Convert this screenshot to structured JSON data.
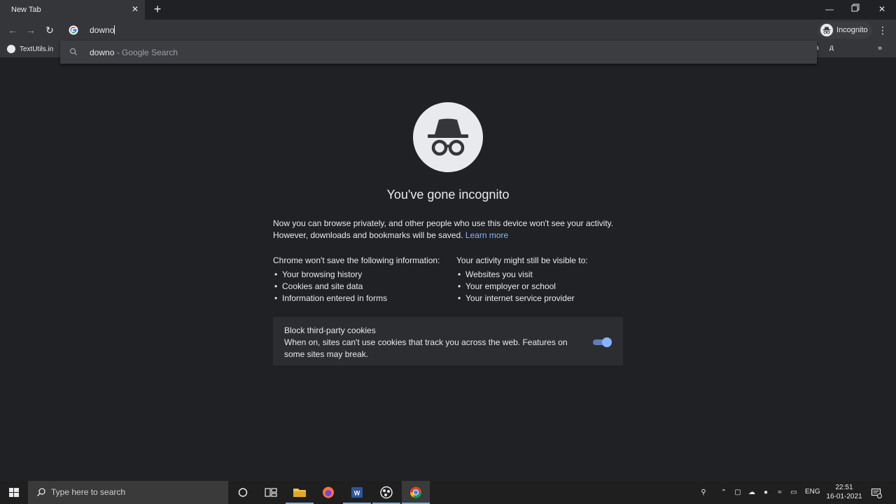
{
  "window": {
    "tab_title": "New Tab",
    "tab_close_icon": "close-icon",
    "new_tab_icon": "plus-icon",
    "controls": [
      "minimize-icon",
      "restore-icon",
      "close-icon"
    ]
  },
  "toolbar": {
    "omnibox_value": "downo",
    "profile_label": "Incognito",
    "menu_icon": "more-vert-icon"
  },
  "omnibox_dropdown": {
    "suggestion_query": "downo",
    "suggestion_suffix": " - Google Search"
  },
  "bookmarks": {
    "items": [
      {
        "label": "TextUtils.in"
      }
    ],
    "right_partial": "a"
  },
  "incognito": {
    "title": "You've gone incognito",
    "intro_line1": "Now you can browse privately, and other people who use this device won't see your activity.",
    "intro_line2": "However, downloads and bookmarks will be saved.",
    "learn_more": "Learn more",
    "left_heading_pre": "Chrome ",
    "left_heading_bold": "won't save",
    "left_heading_post": " the following information:",
    "left_items": [
      "Your browsing history",
      "Cookies and site data",
      "Information entered in forms"
    ],
    "right_heading_pre": "Your activity ",
    "right_heading_bold": "might still be visible",
    "right_heading_post": " to:",
    "right_items": [
      "Websites you visit",
      "Your employer or school",
      "Your internet service provider"
    ],
    "cookie_title": "Block third-party cookies",
    "cookie_desc": "When on, sites can't use cookies that track you across the web. Features on some sites may break.",
    "cookie_toggle_on": true
  },
  "taskbar": {
    "search_placeholder": "Type here to search",
    "language": "ENG",
    "time": "22:51",
    "date": "16-01-2021",
    "accent": "#7fa7d8"
  }
}
